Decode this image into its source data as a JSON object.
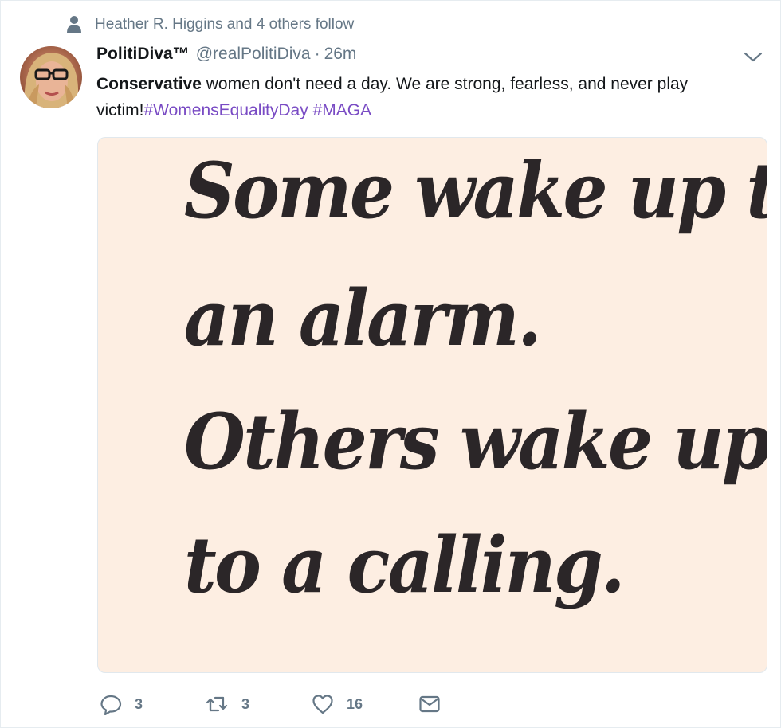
{
  "social_context": {
    "text": "Heather R. Higgins and 4 others follow"
  },
  "author": {
    "name": "PolitiDiva™",
    "handle": "@realPolitiDiva",
    "separator": "·",
    "time": "26m"
  },
  "tweet": {
    "text_bold": "Conservative",
    "text_part1": " women don't need a day. We are strong, fearless, and never play victim!",
    "hashtag1": "#WomensEqualityDay",
    "space": " ",
    "hashtag2": "#MAGA"
  },
  "media": {
    "lines": [
      "Some wake up to",
      "an alarm.",
      "Others wake up",
      "to a calling."
    ],
    "background": "#fdeee2"
  },
  "actions": {
    "reply_count": "3",
    "retweet_count": "3",
    "like_count": "16"
  },
  "icons": {
    "context": "person-icon",
    "caret": "chevron-down-icon",
    "reply": "reply-icon",
    "retweet": "retweet-icon",
    "like": "heart-icon",
    "dm": "envelope-icon"
  },
  "colors": {
    "hashtag": "#794bc4",
    "secondary_text": "#657786"
  }
}
